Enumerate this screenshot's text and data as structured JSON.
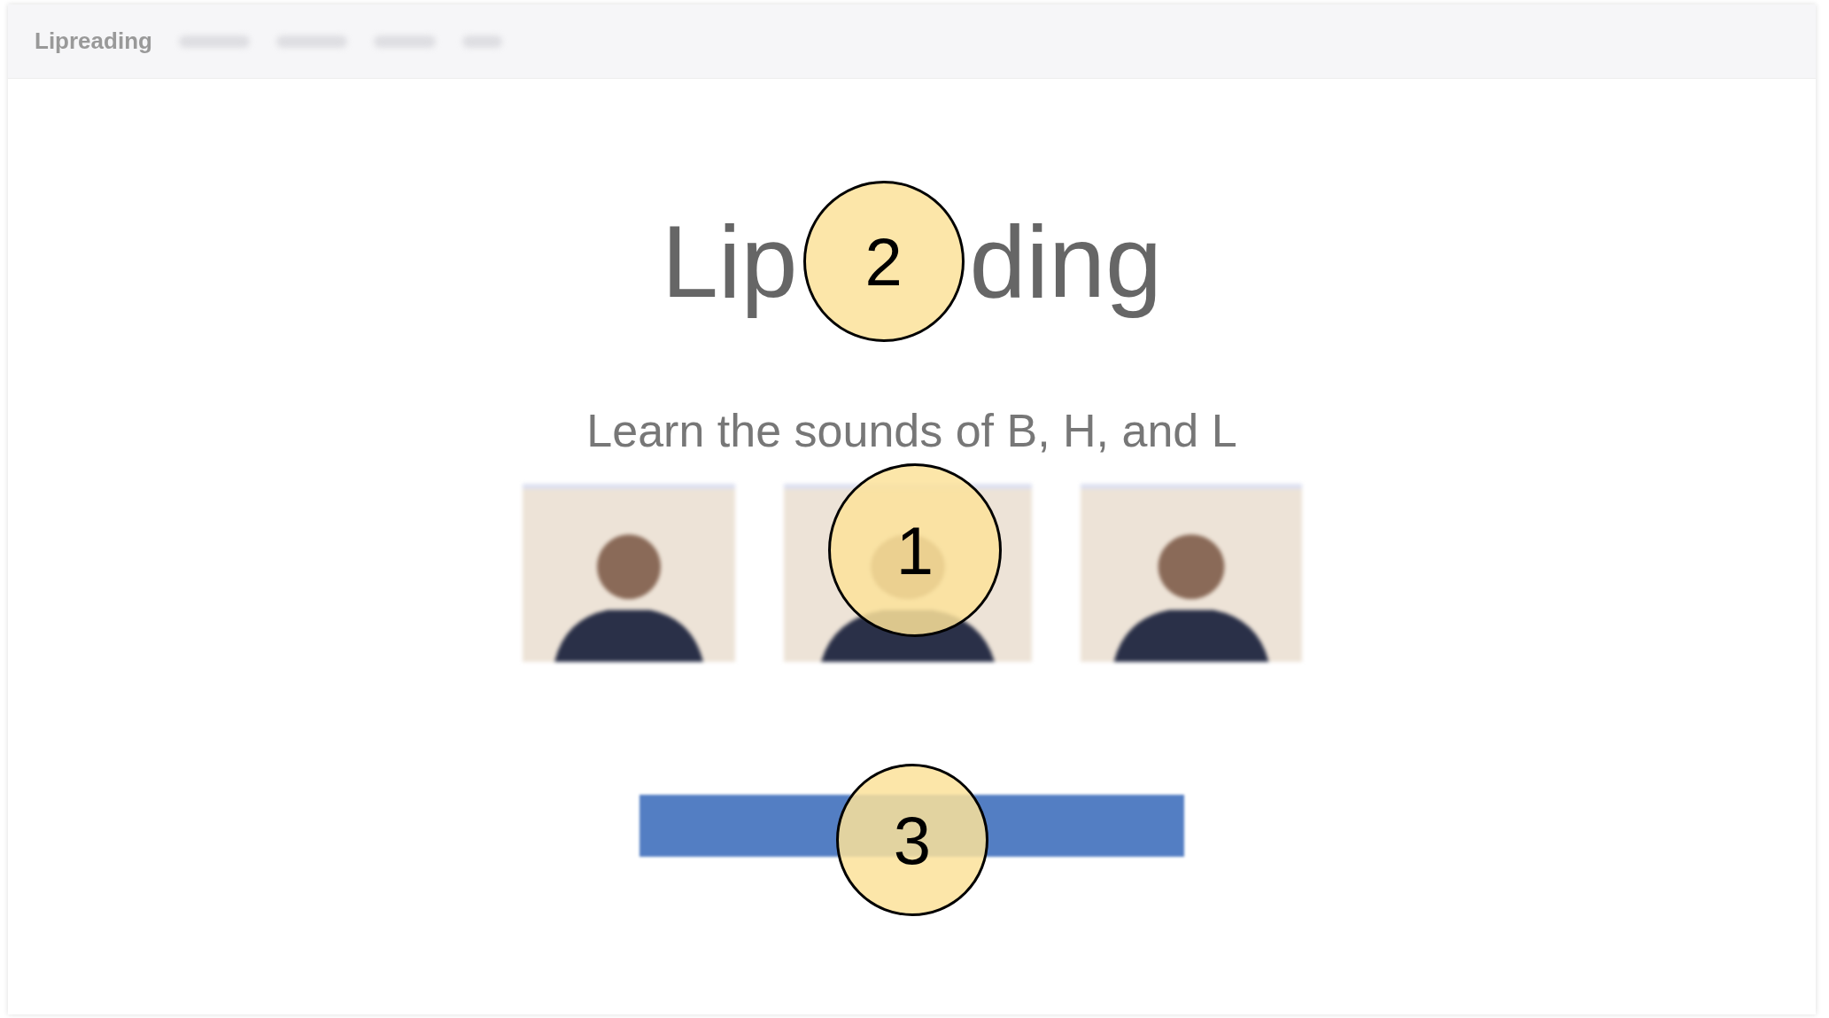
{
  "navbar": {
    "brand": "Lipreading"
  },
  "page": {
    "title_parts": [
      "Lip",
      "ding"
    ],
    "subtitle": "Learn the sounds of B, H, and L"
  },
  "videos": [
    {
      "kind": "video"
    },
    {
      "kind": "video"
    },
    {
      "kind": "video"
    }
  ],
  "callouts": [
    {
      "label": "2"
    },
    {
      "label": "1"
    },
    {
      "label": "3"
    }
  ]
}
